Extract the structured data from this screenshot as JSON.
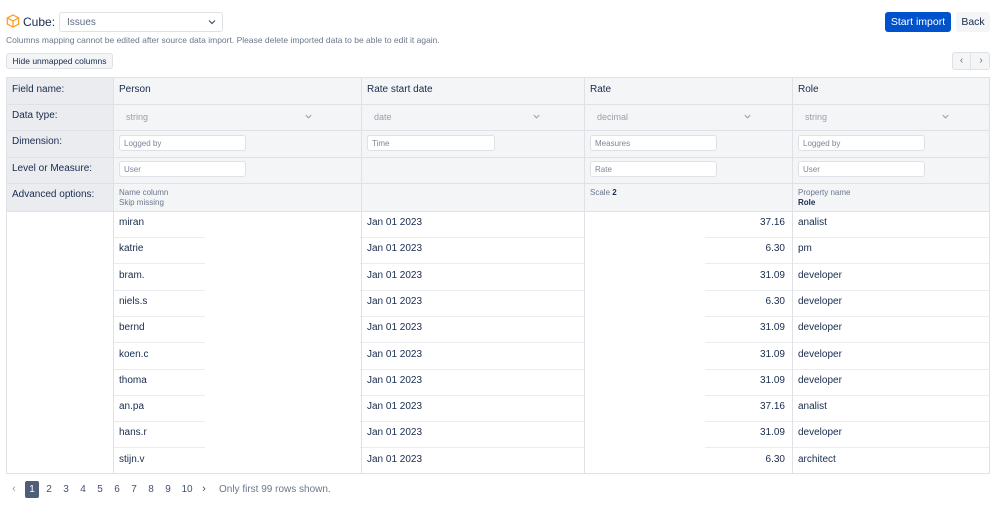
{
  "header": {
    "cube_label": "Cube:",
    "cube_value": "Issues",
    "start_import": "Start import",
    "back": "Back"
  },
  "note": "Columns mapping cannot be edited after source data import. Please delete imported data to be able to edit it again.",
  "hide_unmapped": "Hide unmapped columns",
  "row_labels": {
    "field_name": "Field name:",
    "data_type": "Data type:",
    "dimension": "Dimension:",
    "level_measure": "Level or Measure:",
    "advanced": "Advanced options:"
  },
  "columns": [
    {
      "name": "Person",
      "data_type": "string",
      "dimension": "Logged by",
      "level": "User",
      "adv_line1": "Name column",
      "adv_line2": "Skip missing",
      "adv_value": ""
    },
    {
      "name": "Rate start date",
      "data_type": "date",
      "dimension": "Time",
      "level": "",
      "adv_line1": "",
      "adv_line2": "",
      "adv_value": ""
    },
    {
      "name": "Rate",
      "data_type": "decimal",
      "dimension": "Measures",
      "level": "Rate",
      "adv_line1": "Scale",
      "adv_line2": "",
      "adv_value": "2"
    },
    {
      "name": "Role",
      "data_type": "string",
      "dimension": "Logged by",
      "level": "User",
      "adv_line1": "Property name",
      "adv_line2": "",
      "adv_value": "Role"
    }
  ],
  "rows": [
    {
      "person": "miran",
      "date": "Jan 01 2023",
      "rate": "37.16",
      "role": "analist"
    },
    {
      "person": "katrie",
      "date": "Jan 01 2023",
      "rate": "6.30",
      "role": "pm"
    },
    {
      "person": "bram.",
      "date": "Jan 01 2023",
      "rate": "31.09",
      "role": "developer"
    },
    {
      "person": "niels.s",
      "date": "Jan 01 2023",
      "rate": "6.30",
      "role": "developer"
    },
    {
      "person": "bernd",
      "date": "Jan 01 2023",
      "rate": "31.09",
      "role": "developer"
    },
    {
      "person": "koen.c",
      "date": "Jan 01 2023",
      "rate": "31.09",
      "role": "developer"
    },
    {
      "person": "thoma",
      "date": "Jan 01 2023",
      "rate": "31.09",
      "role": "developer"
    },
    {
      "person": "an.pa",
      "date": "Jan 01 2023",
      "rate": "37.16",
      "role": "analist"
    },
    {
      "person": "hans.r",
      "date": "Jan 01 2023",
      "rate": "31.09",
      "role": "developer"
    },
    {
      "person": "stijn.v",
      "date": "Jan 01 2023",
      "rate": "6.30",
      "role": "architect"
    }
  ],
  "pagination": {
    "prev": "‹",
    "next": "›",
    "pages": [
      "1",
      "2",
      "3",
      "4",
      "5",
      "6",
      "7",
      "8",
      "9",
      "10"
    ],
    "active": "1",
    "info": "Only first 99 rows shown."
  },
  "colors": {
    "primary": "#0052cc",
    "header_bg": "#f4f5f7",
    "label_bg": "#ebecf0",
    "cube_icon": "#ff991f"
  },
  "icons": {
    "cube": "cube-icon",
    "chevron": "chevron-down-icon",
    "arrow_left": "chevron-left-icon",
    "arrow_right": "chevron-right-icon"
  }
}
